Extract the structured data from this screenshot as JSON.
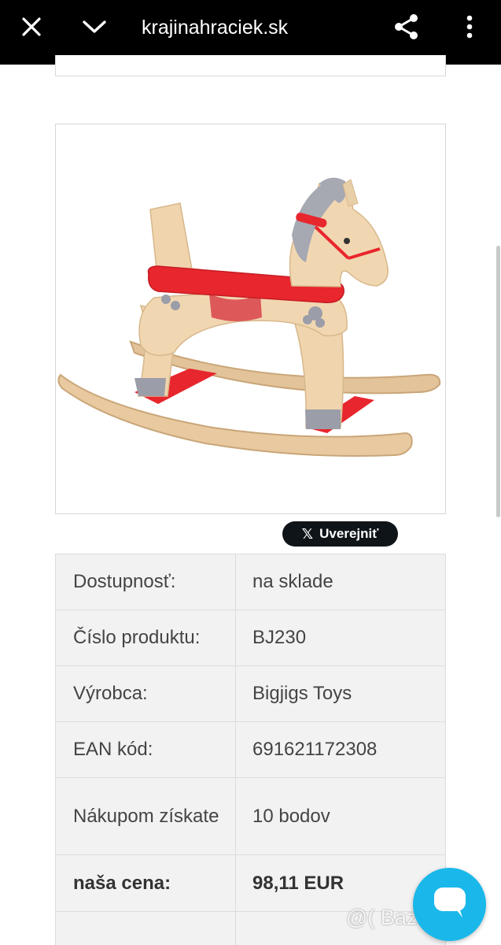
{
  "browser": {
    "url": "krajinahraciek.sk",
    "icons": {
      "close": "close-icon",
      "collapse": "chevron-down-icon",
      "share": "share-icon",
      "menu": "more-vert-icon"
    }
  },
  "product": {
    "image_alt": "wooden rocking horse"
  },
  "social": {
    "x_share_label": "Uverejniť",
    "x_logo": "𝕏"
  },
  "details": [
    {
      "label": "Dostupnosť:",
      "value": "na sklade"
    },
    {
      "label": "Číslo produktu:",
      "value": "BJ230"
    },
    {
      "label": "Výrobca:",
      "value": "Bigjigs Toys"
    },
    {
      "label": "EAN kód:",
      "value": "691621172308"
    },
    {
      "label": "Nákupom získate",
      "value": "10 bodov"
    },
    {
      "label": "naša cena:",
      "value": "98,11 EUR"
    }
  ],
  "chat": {
    "icon": "chat-bubble-icon"
  },
  "watermark": "@( Bazos.sk",
  "colors": {
    "toolbar": "#000000",
    "accent_red": "#e8262d",
    "chat": "#1ab8ea"
  }
}
